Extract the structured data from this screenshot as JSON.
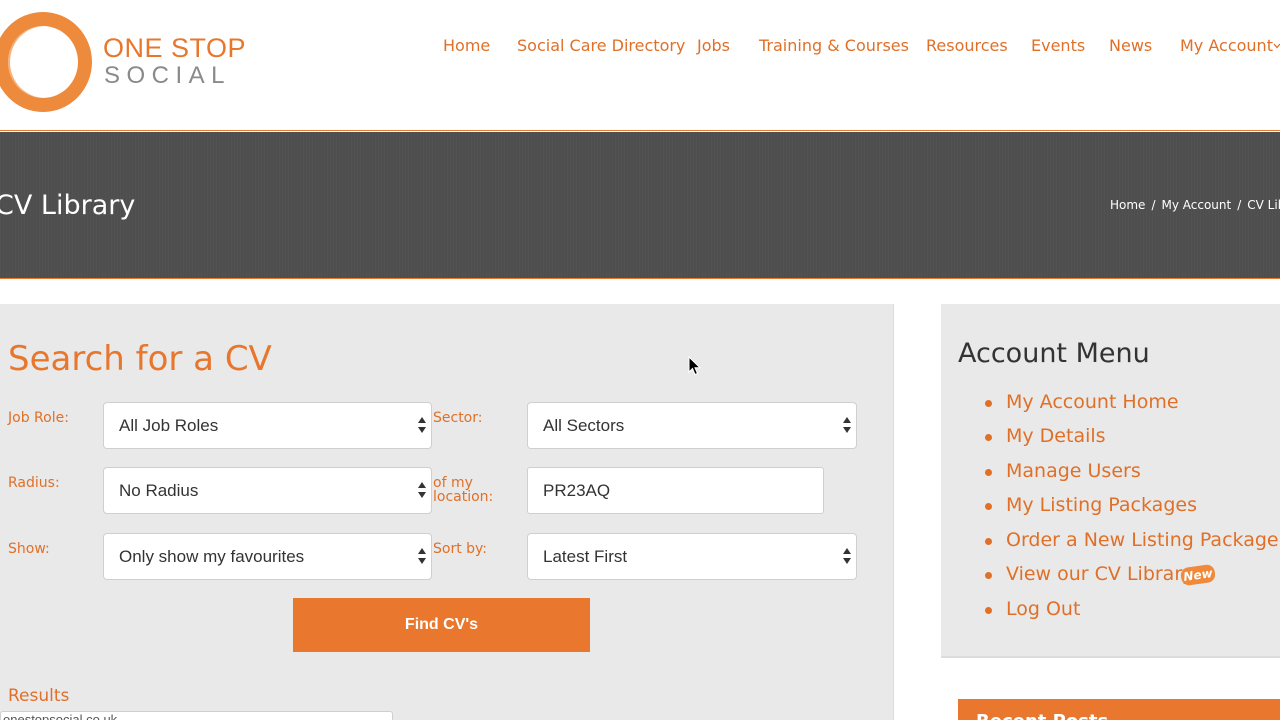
{
  "brand": {
    "name_line1": "ONE STOP",
    "name_line2": "SOCIAL",
    "accent_color": "#e8772e",
    "grey_color": "#8a8a8a"
  },
  "nav": {
    "items": [
      {
        "label": "Home"
      },
      {
        "label": "Social Care Directory"
      },
      {
        "label": "Jobs"
      },
      {
        "label": "Training & Courses"
      },
      {
        "label": "Resources"
      },
      {
        "label": "Events"
      },
      {
        "label": "News"
      },
      {
        "label": "My Account"
      }
    ],
    "dropdown_icon": "chevron-down-icon"
  },
  "banner": {
    "title": "CV Library",
    "background_color": "#4e4e4e",
    "breadcrumb": [
      {
        "label": "Home"
      },
      {
        "label": "My Account"
      },
      {
        "label": "CV Libr"
      }
    ],
    "separator": "/"
  },
  "search": {
    "title": "Search for a CV",
    "fields": {
      "job_role": {
        "label": "Job Role:",
        "value": "All Job Roles"
      },
      "sector": {
        "label": "Sector:",
        "value": "All Sectors"
      },
      "radius": {
        "label": "Radius:",
        "value": "No Radius"
      },
      "location": {
        "label_line1": "of my",
        "label_line2": "location:",
        "value": "PR23AQ"
      },
      "show": {
        "label": "Show:",
        "value": "Only show my favourites"
      },
      "sort": {
        "label": "Sort by:",
        "value": "Latest First"
      }
    },
    "submit_label": "Find CV's",
    "results_label": "Results",
    "results_partial_text": "onestopsocial.co.uk"
  },
  "sidebar": {
    "title": "Account Menu",
    "items": [
      {
        "label": "My Account Home"
      },
      {
        "label": "My Details"
      },
      {
        "label": "Manage Users"
      },
      {
        "label": "My Listing Packages"
      },
      {
        "label": "Order a New Listing Package"
      },
      {
        "label": "View our CV Library"
      },
      {
        "label": "Log Out"
      }
    ],
    "new_badge": "New",
    "next_panel_title": "Recent Posts"
  }
}
